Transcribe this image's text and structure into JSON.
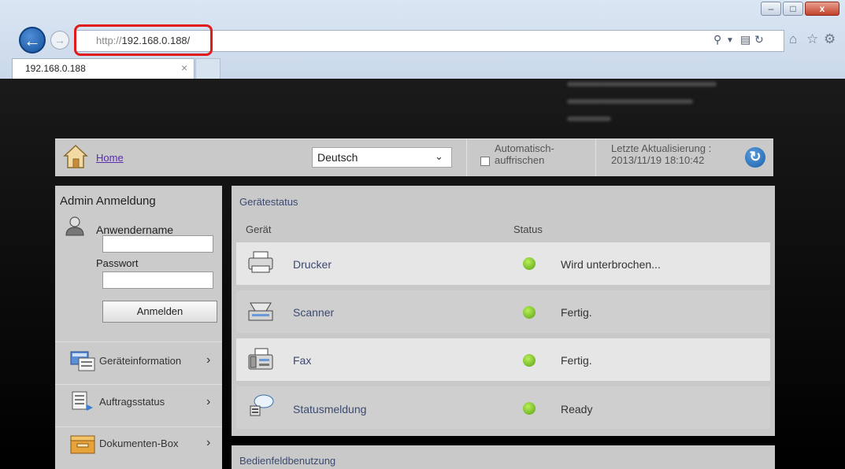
{
  "browser": {
    "url_protocol": "http://",
    "url_host": "192.168.0.188/",
    "tab_title": "192.168.0.188",
    "tab_close": "×",
    "window_buttons": [
      "–",
      "□",
      "x"
    ]
  },
  "header": {
    "home_label": "Home",
    "language": "Deutsch",
    "auto_refresh_line1": "Automatisch-",
    "auto_refresh_line2": "auffrischen",
    "last_update_line1": "Letzte Aktualisierung :",
    "last_update_line2": "2013/11/19 18:10:42"
  },
  "login": {
    "title": "Admin Anmeldung",
    "username_label": "Anwendername",
    "password_label": "Passwort",
    "login_button": "Anmelden"
  },
  "nav": [
    {
      "label": "Geräteinformation",
      "icon": "device-info-icon"
    },
    {
      "label": "Auftragsstatus",
      "icon": "job-status-icon"
    },
    {
      "label": "Dokumenten-Box",
      "icon": "document-box-icon"
    }
  ],
  "device_status": {
    "title": "Gerätestatus",
    "col_device": "Gerät",
    "col_status": "Status",
    "rows": [
      {
        "device": "Drucker",
        "status": "Wird unterbrochen...",
        "icon": "printer-icon"
      },
      {
        "device": "Scanner",
        "status": "Fertig.",
        "icon": "scanner-icon"
      },
      {
        "device": "Fax",
        "status": "Fertig.",
        "icon": "fax-icon"
      },
      {
        "device": "Statusmeldung",
        "status": "Ready",
        "icon": "status-message-icon"
      }
    ]
  },
  "panel_usage": {
    "title": "Bedienfeldbenutzung"
  },
  "colors": {
    "status_ok": "#7ccc2a",
    "highlight": "#e11b1b",
    "link": "#5a2cae"
  }
}
